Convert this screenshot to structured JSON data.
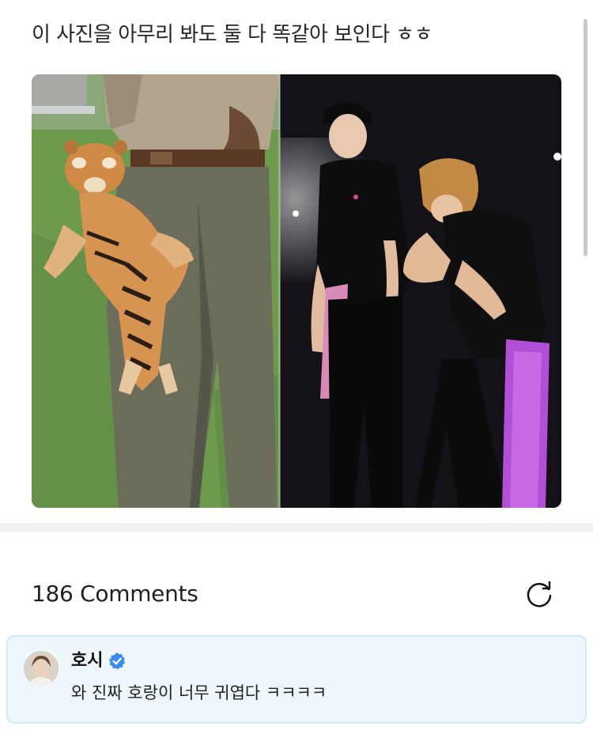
{
  "post": {
    "text": "이 사진을 아무리 봐도 둘 다 똑같아 보인다 ㅎㅎ",
    "image_icon": "tiger-and-performer-comparison-photo"
  },
  "comments": {
    "count_label": "186 Comments",
    "refresh_icon": "refresh-icon",
    "items": [
      {
        "author": "호시",
        "verified_icon": "verified-badge-icon",
        "text": "와 진짜 호랑이 너무 귀엽다 ㅋㅋㅋㅋ"
      }
    ]
  },
  "colors": {
    "accent": "#3d8bef",
    "card_bg": "#eef7fc",
    "card_border": "#cfe9f8"
  }
}
